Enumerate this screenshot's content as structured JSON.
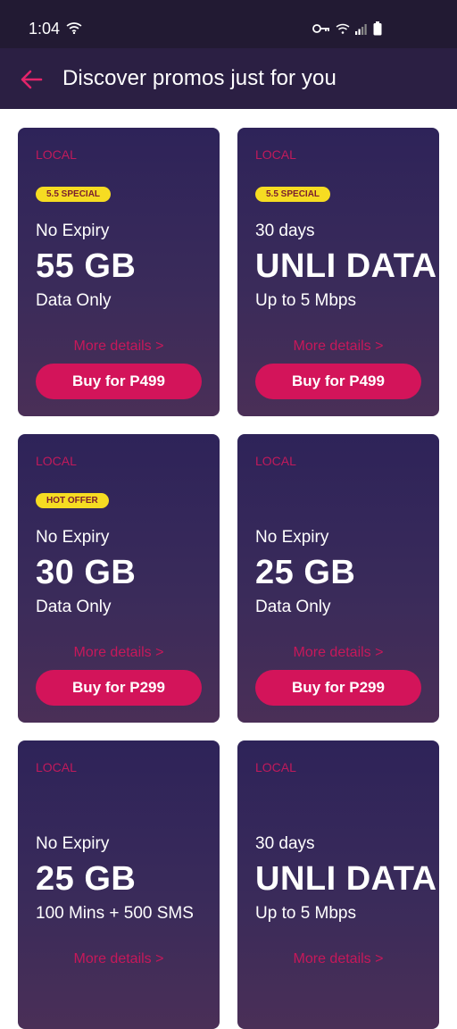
{
  "status": {
    "time": "1:04"
  },
  "header": {
    "title": "Discover promos just for you"
  },
  "colors": {
    "accent": "#d3145a",
    "badge": "#f6dc22",
    "card_bg": "#2e2359",
    "appbar": "#2b1f43"
  },
  "promos": [
    {
      "region": "LOCAL",
      "badge": "5.5 SPECIAL",
      "validity": "No Expiry",
      "amount": "55 GB",
      "desc": "Data Only",
      "more": "More details >",
      "buy": "Buy for P499"
    },
    {
      "region": "LOCAL",
      "badge": "5.5 SPECIAL",
      "validity": "30 days",
      "amount": "UNLI DATA",
      "desc": "Up to 5 Mbps",
      "more": "More details >",
      "buy": "Buy for P499"
    },
    {
      "region": "LOCAL",
      "badge": "HOT OFFER",
      "validity": "No Expiry",
      "amount": "30 GB",
      "desc": "Data Only",
      "more": "More details >",
      "buy": "Buy for P299"
    },
    {
      "region": "LOCAL",
      "badge": "",
      "validity": "No Expiry",
      "amount": "25 GB",
      "desc": "Data Only",
      "more": "More details >",
      "buy": "Buy for P299"
    },
    {
      "region": "LOCAL",
      "badge": "",
      "validity": "No Expiry",
      "amount": "25 GB",
      "desc": "100 Mins + 500 SMS",
      "more": "More details >",
      "buy": ""
    },
    {
      "region": "LOCAL",
      "badge": "",
      "validity": "30 days",
      "amount": "UNLI DATA",
      "desc": "Up to 5 Mbps",
      "more": "More details >",
      "buy": ""
    }
  ]
}
